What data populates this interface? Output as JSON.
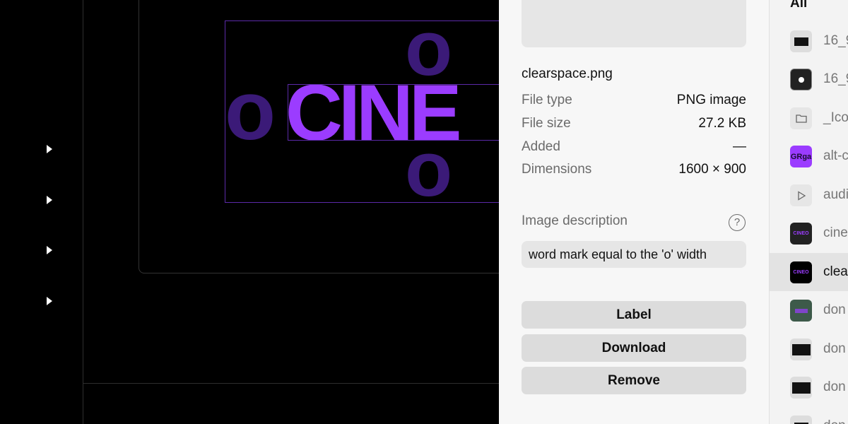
{
  "canvas": {
    "wordmark": "CINE",
    "clearspace_letter": "o"
  },
  "details": {
    "filename": "clearspace.png",
    "meta": [
      {
        "key": "File type",
        "value": "PNG image"
      },
      {
        "key": "File size",
        "value": "27.2 KB"
      },
      {
        "key": "Added",
        "value": "—"
      },
      {
        "key": "Dimensions",
        "value": "1600 × 900"
      }
    ],
    "description_label": "Image description",
    "help_glyph": "?",
    "description_value": "word mark equal to the 'o' width",
    "buttons": {
      "label": "Label",
      "download": "Download",
      "remove": "Remove"
    }
  },
  "filelist": {
    "header": "All",
    "items": [
      {
        "name": "16_9",
        "thumb": "dark-small",
        "selected": false
      },
      {
        "name": "16_9",
        "thumb": "dark-icon",
        "selected": false
      },
      {
        "name": "_Ico",
        "thumb": "folder-icon",
        "selected": false
      },
      {
        "name": "alt-c",
        "thumb": "purple-text",
        "selected": false,
        "thumb_text": "GRga"
      },
      {
        "name": "audi",
        "thumb": "play-icon",
        "selected": false
      },
      {
        "name": "cine",
        "thumb": "cine-logo",
        "selected": false
      },
      {
        "name": "clea",
        "thumb": "cine-logo",
        "selected": true
      },
      {
        "name": "don",
        "thumb": "green-photo",
        "selected": false
      },
      {
        "name": "don",
        "thumb": "dark-text",
        "selected": false
      },
      {
        "name": "don",
        "thumb": "dark-text",
        "selected": false
      },
      {
        "name": "don",
        "thumb": "dark-small",
        "selected": false
      }
    ]
  },
  "colors": {
    "accent": "#9b3cff",
    "accent_dark": "#3b1a78",
    "panel_bg": "#f7f7f7",
    "button_bg": "#dcdcdc"
  }
}
